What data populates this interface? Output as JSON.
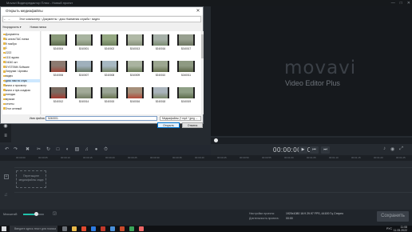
{
  "app": {
    "title": "Movavi Видеоредактор Плюс - Новый проект"
  },
  "dialog": {
    "title": "Открыть медиафайлы",
    "address": "Этот компьютер › Документы › диск Наименая служба › видео",
    "toolbar_organize": "Упорядочить ▾",
    "toolbar_newfolder": "Новая папка",
    "sidebar": [
      "Документы",
      "А альта ПАС папка",
      "9 ноября",
      "1",
      "2222",
      "1111 вдова",
      "24040 окт",
      "SYSTEMN Software",
      "Загрузки / Архивы",
      "видео",
      "диск нам по служ",
      "книги и просмотр",
      "книги и пре-ссадная",
      "поездка",
      "музыка",
      "отчеты",
      "Этот сетевой"
    ],
    "sidebar_selected_index": 10,
    "files": [
      {
        "name": "5240004",
        "c1": "#8a9a7a",
        "c2": "#5a6a4a"
      },
      {
        "name": "5240001",
        "c1": "#a8b4a0",
        "c2": "#7d8a6e"
      },
      {
        "name": "5240002",
        "c1": "#95a882",
        "c2": "#6c7f5c"
      },
      {
        "name": "5240013",
        "c1": "#b0b9a6",
        "c2": "#858f78"
      },
      {
        "name": "5240016",
        "c1": "#a6b0a8",
        "c2": "#7a8c70"
      },
      {
        "name": "5240017",
        "c1": "#98a090",
        "c2": "#6a735e"
      },
      {
        "name": "5240006",
        "c1": "#8c7a70",
        "c2": "#a1493c"
      },
      {
        "name": "5240007",
        "c1": "#9fb0bc",
        "c2": "#6b7a66"
      },
      {
        "name": "5240008",
        "c1": "#a7b8c2",
        "c2": "#768466"
      },
      {
        "name": "5240009",
        "c1": "#aab3a0",
        "c2": "#6d7d5a"
      },
      {
        "name": "5240010",
        "c1": "#9ca690",
        "c2": "#66704f"
      },
      {
        "name": "5240011",
        "c1": "#8e9a82",
        "c2": "#5b6648"
      },
      {
        "name": "5240012",
        "c1": "#7a6a60",
        "c2": "#a33a30"
      },
      {
        "name": "5240014",
        "c1": "#a2aa98",
        "c2": "#727c62"
      },
      {
        "name": "5240015",
        "c1": "#9ba596",
        "c2": "#6a7552"
      },
      {
        "name": "5240016",
        "c1": "#a58f7a",
        "c2": "#b04a38"
      },
      {
        "name": "5240018",
        "c1": "#aab4bc",
        "c2": "#7c8a6c"
      },
      {
        "name": "5240019",
        "c1": "#8f9f86",
        "c2": "#5c6b4b"
      }
    ],
    "filename_label": "Имя файла:",
    "filename_value": "5240001",
    "filter_value": "Медиафайлы (*.mp4 *.jpeg ...",
    "open_label": "Открыть",
    "cancel_label": "Отмена"
  },
  "preview": {
    "logo": "movavi",
    "subtitle": "Video Editor Plus",
    "timecode": "00:00:00.000"
  },
  "timeline": {
    "ticks": [
      "00:00:00",
      "00:00:05",
      "00:00:10",
      "00:00:15",
      "00:00:20",
      "00:00:25",
      "00:00:30",
      "00:00:35",
      "00:00:40",
      "00:00:45",
      "00:00:50",
      "00:00:55",
      "00:01:00",
      "00:01:05",
      "00:01:10",
      "00:01:15",
      "00:01:20",
      "00:01:25"
    ],
    "drop_hint": "Перетащите медиафайлы сюда",
    "scale_label": "Масштаб:"
  },
  "project": {
    "settings_label": "Настройки проекта:",
    "settings_value": "1920x1080  16:9  29.97 FPS, 44100 Гц Стерео",
    "duration_label": "Длительность проекта:",
    "duration_value": "00:00",
    "save_label": "Сохранить"
  },
  "taskbar": {
    "search": "Введите здесь текст для поиска",
    "time": "11:08",
    "date": "11.05.2022",
    "lang": "РУС"
  }
}
